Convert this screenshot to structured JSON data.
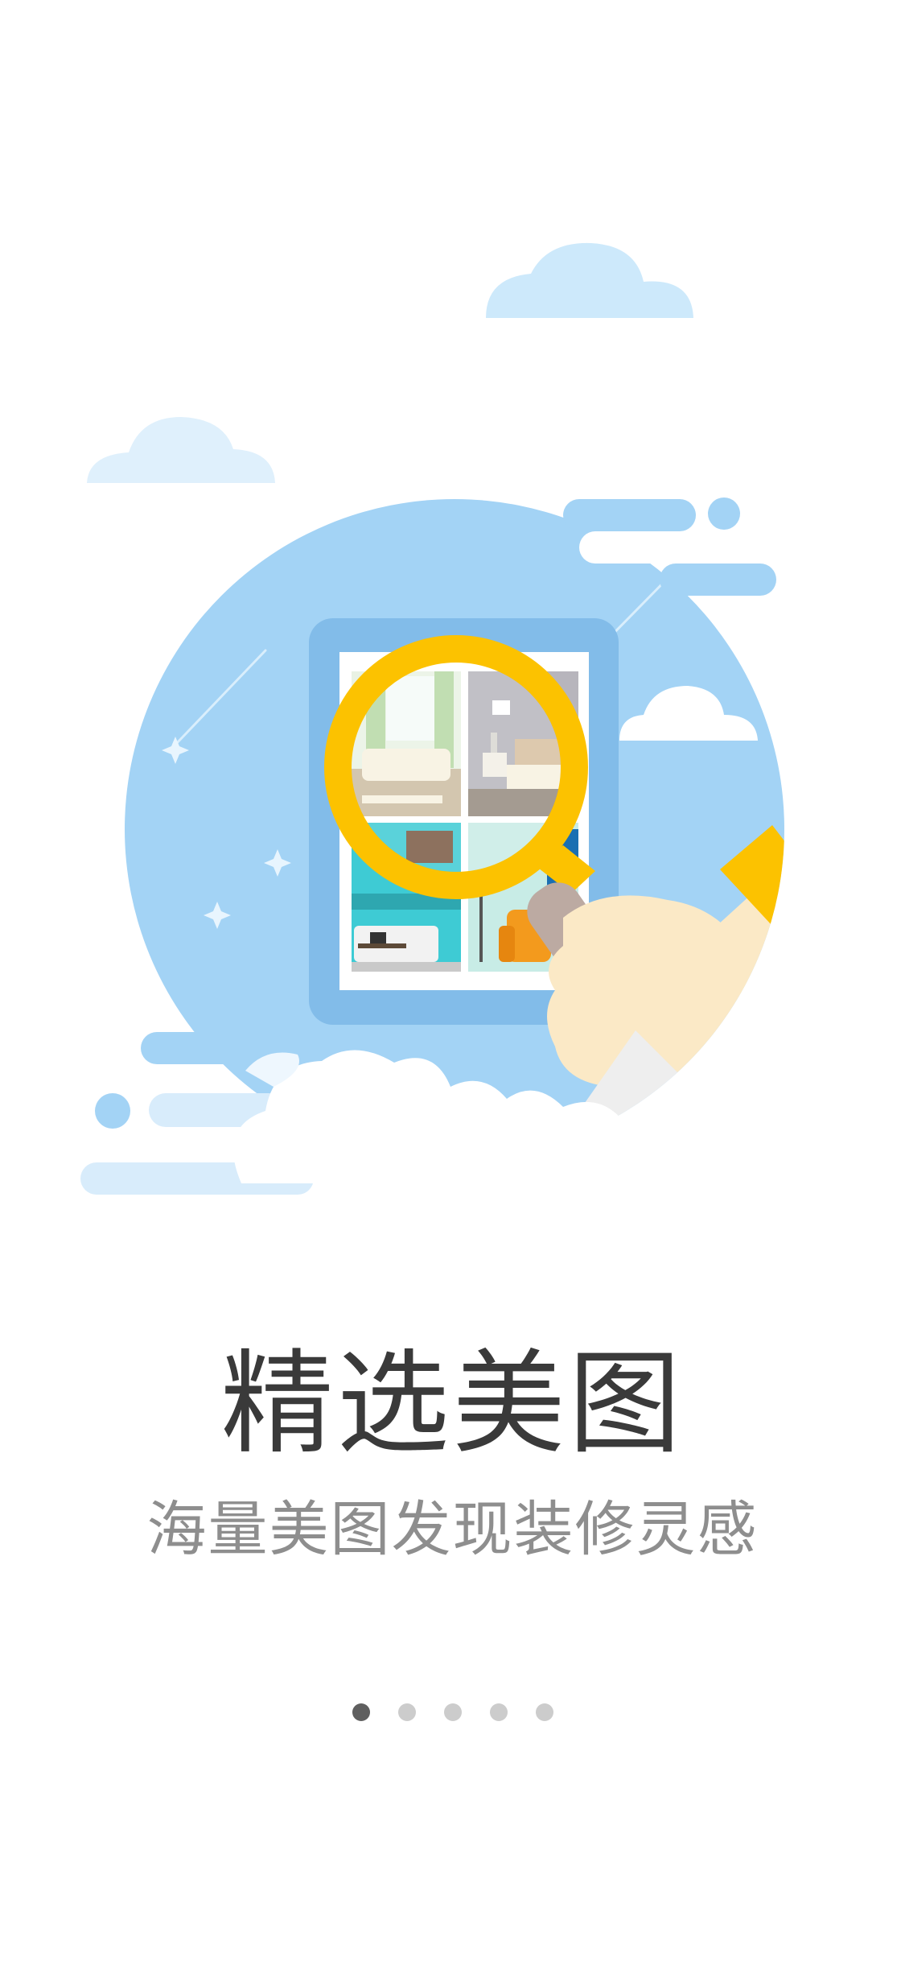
{
  "onboarding": {
    "title": "精选美图",
    "subtitle": "海量美图发现装修灵感",
    "illustration_icon": "magnifier-over-photo-gallery",
    "page_indicator": {
      "total": 5,
      "current": 1
    }
  },
  "colors": {
    "background": "#ffffff",
    "sky_circle": "#a3d3f5",
    "frame": "#82bce9",
    "magnifier": "#fcc200",
    "hand": "#fbe9c6",
    "title_text": "#3a3a3a",
    "subtitle_text": "#8e8e8e",
    "dot_active": "#5f5f5f",
    "dot_inactive": "#cccccc"
  }
}
